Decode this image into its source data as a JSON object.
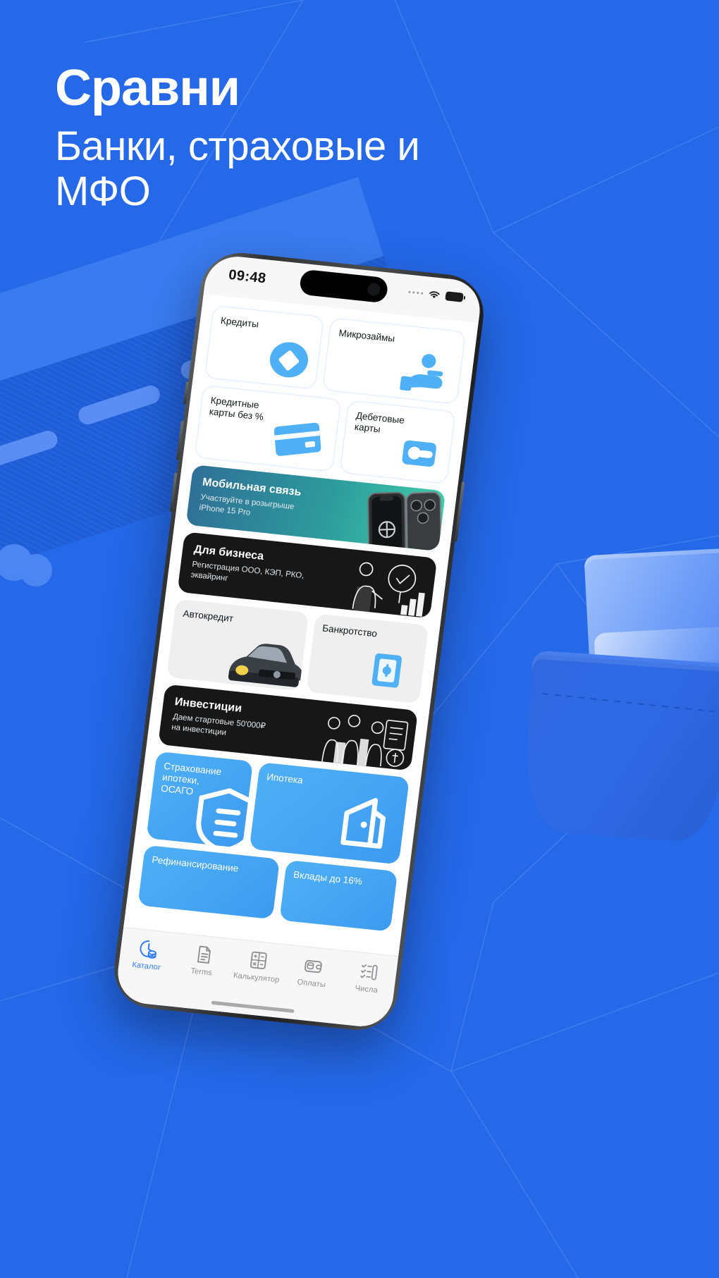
{
  "brand": {
    "title": "Сравни",
    "subtitle": "Банки, страховые и МФО",
    "accent_blue": "#2568e8",
    "tile_blue": "#4fb0f5",
    "dark_card": "#171717"
  },
  "phone": {
    "status_bar": {
      "time": "09:48",
      "signal_icon": "signal-dots-icon",
      "wifi_icon": "wifi-icon",
      "battery_icon": "battery-icon"
    }
  },
  "catalog": {
    "tiles": [
      {
        "label": "Кредиты",
        "icon": "diamond-coin-icon",
        "style": "white"
      },
      {
        "label": "Микрозаймы",
        "icon": "handshake-cash-icon",
        "style": "white"
      },
      {
        "label": "Кредитные\nкарты без %",
        "icon": "credit-card-icon",
        "style": "white"
      },
      {
        "label": "Дебетовые\nкарты",
        "icon": "debit-wallet-icon",
        "style": "white"
      },
      {
        "label": "Автокредит",
        "icon": "car-icon",
        "style": "grey"
      },
      {
        "label": "Банкротство",
        "icon": "safe-box-icon",
        "style": "grey"
      },
      {
        "label": "Страхование\nипотеки,\nОСАГО",
        "icon": "shield-icon",
        "style": "blue"
      },
      {
        "label": "Ипотека",
        "icon": "house-door-icon",
        "style": "blue"
      },
      {
        "label": "Рефинансирование",
        "icon": "refinance-icon",
        "style": "blue"
      },
      {
        "label": "Вклады до 16%",
        "icon": "deposit-icon",
        "style": "blue"
      }
    ],
    "banners": [
      {
        "title": "Мобильная связь",
        "subtitle": "Участвуйте в розыгрыше\niPhone 15 Pro",
        "style": "green",
        "art": "iphone-15-pro-art"
      },
      {
        "title": "Для бизнеса",
        "subtitle": "Регистрация ООО, КЭП, РКО,\nэквайринг",
        "style": "dark",
        "art": "business-person-art"
      },
      {
        "title": "Инвестиции",
        "subtitle": "Даем стартовые 50'000₽\nна инвестиции",
        "style": "dark",
        "art": "investors-art"
      }
    ]
  },
  "tabbar": {
    "items": [
      {
        "label": "Каталог",
        "icon": "catalog-clock-coins-icon",
        "active": true
      },
      {
        "label": "Terms",
        "icon": "document-icon",
        "active": false
      },
      {
        "label": "Калькулятор",
        "icon": "calculator-icon",
        "active": false
      },
      {
        "label": "Оплаты",
        "icon": "payments-wallet-icon",
        "active": false
      },
      {
        "label": "Числа",
        "icon": "numbers-list-icon",
        "active": false
      }
    ]
  },
  "decor": {
    "left_graphic": "road-ribbon-graphic",
    "right_graphic": "wallet-with-cards-graphic"
  }
}
